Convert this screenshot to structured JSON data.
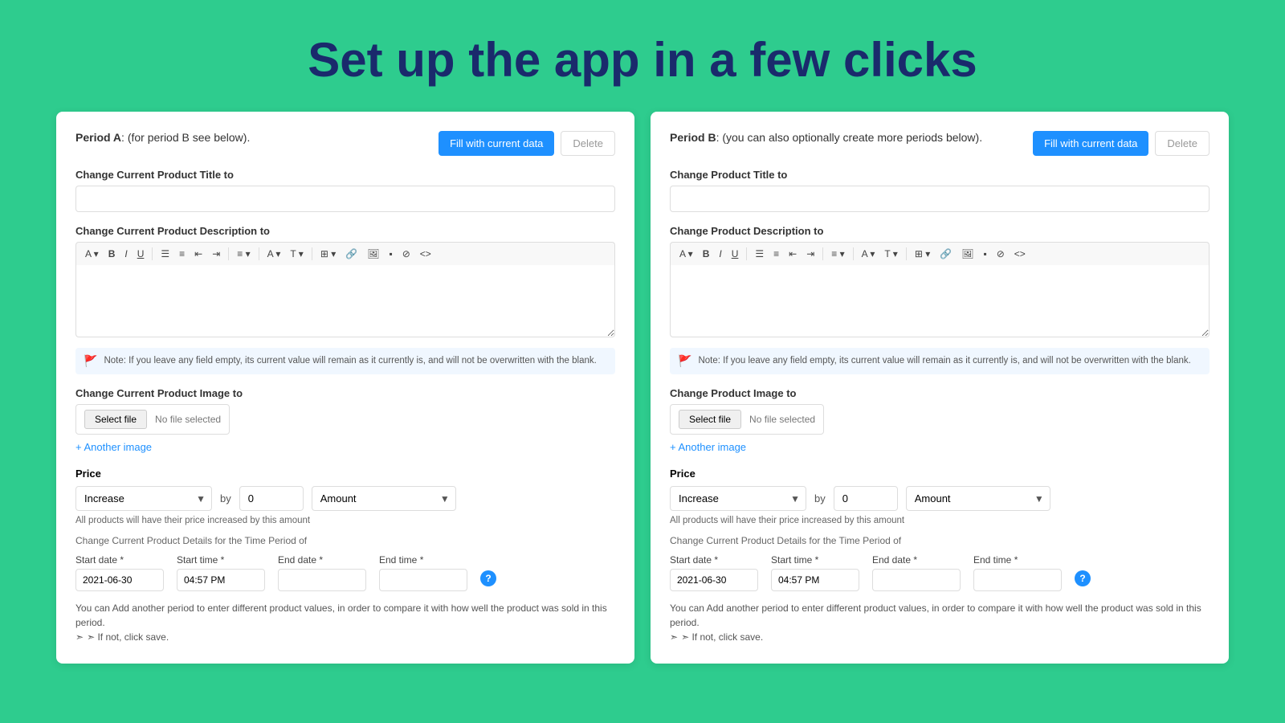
{
  "header": {
    "title": "Set up the app in a few clicks"
  },
  "panel_a": {
    "period_label": "Period A",
    "period_subtitle": ": (for period B see below).",
    "btn_fill": "Fill with current data",
    "btn_delete": "Delete",
    "change_title_label": "Change Current Product Title to",
    "change_title_placeholder": "",
    "change_desc_label": "Change Current Product Description to",
    "note_text": "Note: If you leave any field empty, its current value will remain as it currently is, and will not be overwritten with the blank.",
    "change_image_label": "Change Current Product Image to",
    "btn_select_file": "Select file",
    "no_file_text": "No file selected",
    "add_image_link": "+ Another image",
    "price_label": "Price",
    "price_increase": "Increase",
    "price_by": "by",
    "price_amount_value": "0",
    "price_amount_dropdown": "Amount",
    "price_note": "All products will have their price increased by this amount",
    "time_period_label": "Change Current Product Details for the Time Period of",
    "start_date_label": "Start date *",
    "start_time_label": "Start time *",
    "end_date_label": "End date *",
    "end_time_label": "End time *",
    "start_date_value": "2021-06-30",
    "start_time_value": "04:57 PM",
    "end_date_value": "",
    "end_time_value": "",
    "save_note": "You can Add another period to enter different product values, in order to compare it with how well the product was sold in this period.",
    "save_note2": "➣ If not, click save."
  },
  "panel_b": {
    "period_label": "Period B",
    "period_subtitle": ": (you can also optionally create more periods below).",
    "btn_fill": "Fill with current data",
    "btn_delete": "Delete",
    "change_title_label": "Change Product Title to",
    "change_title_placeholder": "",
    "change_desc_label": "Change Product Description to",
    "note_text": "Note: If you leave any field empty, its current value will remain as it currently is, and will not be overwritten with the blank.",
    "change_image_label": "Change Product Image to",
    "btn_select_file": "Select file",
    "no_file_text": "No file selected",
    "add_image_link": "+ Another image",
    "price_label": "Price",
    "price_increase": "Increase",
    "price_by": "by",
    "price_amount_value": "0",
    "price_amount_dropdown": "Amount",
    "price_note": "All products will have their price increased by this amount",
    "time_period_label": "Change Current Product Details for the Time Period of",
    "start_date_label": "Start date *",
    "start_time_label": "Start time *",
    "end_date_label": "End date *",
    "end_time_label": "End time *",
    "start_date_value": "2021-06-30",
    "start_time_value": "04:57 PM",
    "end_date_value": "",
    "end_time_value": "",
    "save_note": "You can Add another period to enter different product values, in order to compare it with how well the product was sold in this period.",
    "save_note2": "➣ If not, click save."
  },
  "toolbar": {
    "items": [
      "A▾",
      "B",
      "I",
      "U",
      "≡",
      "≡",
      "⬛",
      "⬛",
      "A▾",
      "T▾",
      "⊞▾",
      "🔗",
      "🖼",
      "▪",
      "⊘",
      "<>"
    ]
  }
}
